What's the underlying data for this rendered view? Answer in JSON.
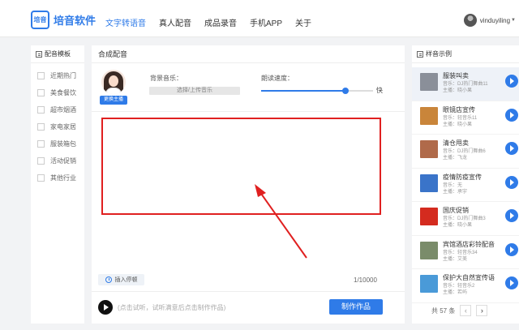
{
  "app": {
    "logo_mark": "培音",
    "name": "培音软件"
  },
  "nav": {
    "items": [
      "文字转语音",
      "真人配音",
      "成品录音",
      "手机APP",
      "关于"
    ],
    "active_index": 0
  },
  "user": {
    "name": "vinduyiling"
  },
  "colors": {
    "accent": "#2f7be8",
    "highlight_border": "#e02020"
  },
  "left_panel": {
    "title": "配音模板",
    "categories": [
      "近期热门",
      "美食餐饮",
      "超市烟酒",
      "家电家居",
      "服装箱包",
      "活动促销",
      "其他行业"
    ]
  },
  "center": {
    "title": "合成配音",
    "swap_voice": "更换主播",
    "bgm_label": "背景音乐：",
    "bgm_select": "选择/上传音乐",
    "speed_label": "朗读速度：",
    "speed_fast": "快",
    "speed_level": 0.75,
    "insert_pause": "插入停顿",
    "char_count": "1/10000",
    "hint": "(点击试听，试听满意后点击制作作品)",
    "make_button": "制作作品"
  },
  "right_panel": {
    "title": "样音示例",
    "samples": [
      {
        "title": "服装叫卖",
        "music": "音乐：DJ热门舞曲11",
        "anchor": "主播：晓小果",
        "thumb": "#8a8f99"
      },
      {
        "title": "眼镜店宣传",
        "music": "音乐：轻音乐11",
        "anchor": "主播：晓小果",
        "thumb": "#c9853a"
      },
      {
        "title": "清仓甩卖",
        "music": "音乐：DJ热门舞曲6",
        "anchor": "主播：飞龙",
        "thumb": "#b06a4a"
      },
      {
        "title": "疫情防疫宣传",
        "music": "音乐：无",
        "anchor": "主播：承宇",
        "thumb": "#3a74c9"
      },
      {
        "title": "国庆促销",
        "music": "音乐：DJ热门舞曲3",
        "anchor": "主播：晓小果",
        "thumb": "#d42b1f"
      },
      {
        "title": "宾馆酒店彩铃配音",
        "music": "音乐：轻音乐34",
        "anchor": "主播：艾美",
        "thumb": "#7a8c6a"
      },
      {
        "title": "保护大自然宣传语",
        "music": "音乐：轻音乐2",
        "anchor": "主播：若屿",
        "thumb": "#4a9ad8"
      }
    ],
    "total": "共 57 条",
    "prev": "‹",
    "next": "›"
  }
}
